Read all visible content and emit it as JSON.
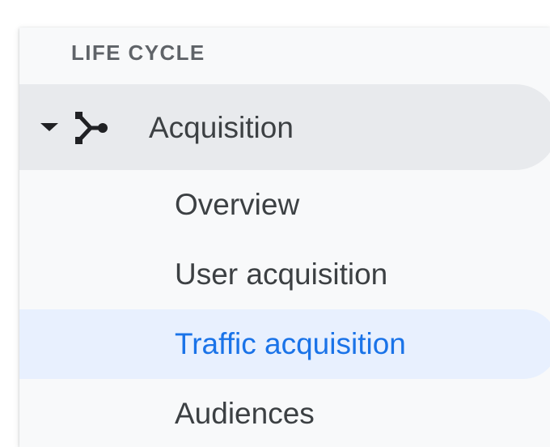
{
  "nav": {
    "section_label": "LIFE CYCLE",
    "group": {
      "label": "Acquisition",
      "icon": "acquisition-branch-icon",
      "expanded": true
    },
    "items": [
      {
        "label": "Overview",
        "active": false
      },
      {
        "label": "User acquisition",
        "active": false
      },
      {
        "label": "Traffic acquisition",
        "active": true
      },
      {
        "label": "Audiences",
        "active": false
      }
    ]
  },
  "colors": {
    "panel_bg": "#f8f9fa",
    "group_bg": "#e8eaed",
    "active_bg": "#e8f0fe",
    "active_text": "#1a73e8",
    "text": "#3c4043",
    "section_text": "#5f6368",
    "icon": "#202124"
  }
}
